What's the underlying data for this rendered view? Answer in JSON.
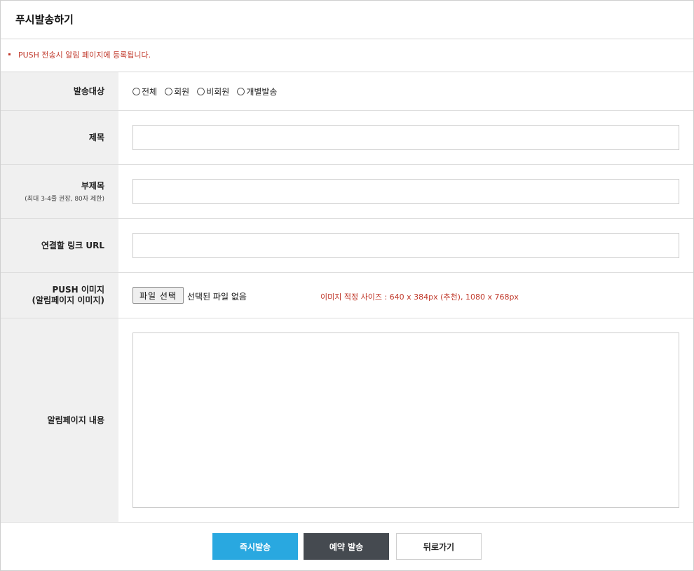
{
  "header": {
    "title": "푸시발송하기"
  },
  "notice": {
    "text": "PUSH 전송시 알림 페이지에 등록됩니다."
  },
  "form": {
    "target": {
      "label": "발송대상",
      "options": [
        "전체",
        "회원",
        "비회원",
        "개별발송"
      ]
    },
    "subject": {
      "label": "제목",
      "value": ""
    },
    "subtitle": {
      "label": "부제목",
      "hint": "(최대 3-4줄 권장, 80자 제한)",
      "value": ""
    },
    "link": {
      "label": "연결할 링크 URL",
      "value": ""
    },
    "image": {
      "label_line1": "PUSH 이미지",
      "label_line2": "(알림페이지 이미지)",
      "file_button": "파일 선택",
      "file_status": "선택된 파일 없음",
      "size_hint": "이미지 적정 사이즈 : 640 x 384px (추천), 1080 x 768px"
    },
    "content": {
      "label": "알림페이지 내용",
      "value": ""
    }
  },
  "actions": {
    "send_now": "즉시발송",
    "reserve": "예약 발송",
    "back": "뒤로가기"
  },
  "colors": {
    "accent": "#29a8e0",
    "dark_button": "#454a50",
    "notice_red": "#c0392b",
    "label_bg": "#f0f0f0"
  }
}
